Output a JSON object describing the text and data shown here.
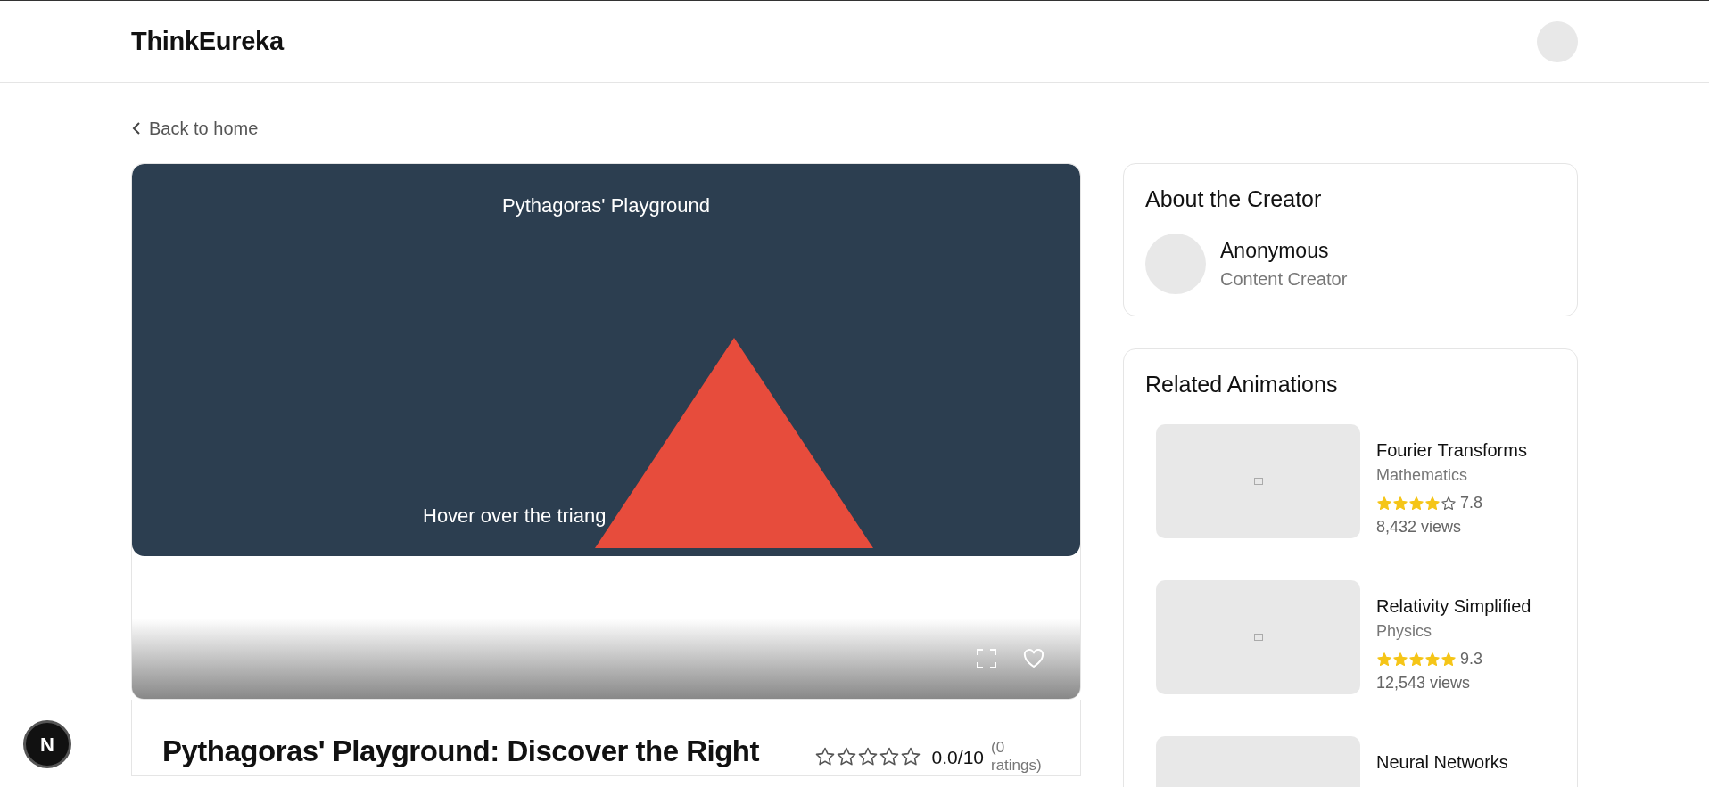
{
  "header": {
    "logo": "ThinkEureka"
  },
  "back_link": {
    "label": "Back to home"
  },
  "animation": {
    "title": "Pythagoras' Playground",
    "hint": "Hover over the triang"
  },
  "player": {
    "favorited": false
  },
  "details": {
    "title": "Pythagoras' Playground: Discover the Right",
    "stars": 0,
    "score": "0.0/10",
    "ratings": "(0 ratings)"
  },
  "creator": {
    "heading": "About the Creator",
    "name": "Anonymous",
    "role": "Content Creator"
  },
  "related": {
    "heading": "Related Animations",
    "items": [
      {
        "title": "Fourier Transforms",
        "category": "Mathematics",
        "stars": 4,
        "score": "7.8",
        "views": "8,432 views"
      },
      {
        "title": "Relativity Simplified",
        "category": "Physics",
        "stars": 5,
        "score": "9.3",
        "views": "12,543 views"
      },
      {
        "title": "Neural Networks"
      }
    ]
  },
  "dev_badge": {
    "label": "N"
  }
}
